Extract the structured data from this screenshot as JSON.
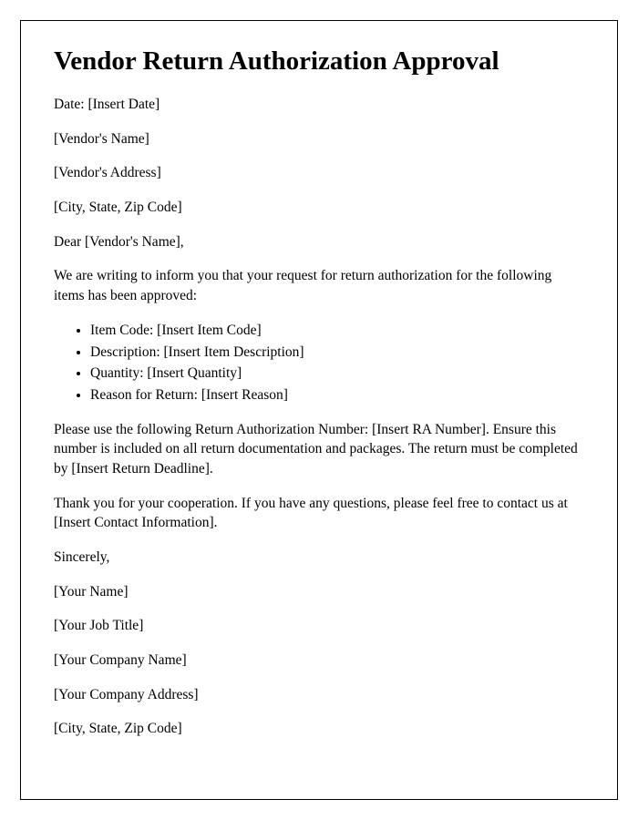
{
  "title": "Vendor Return Authorization Approval",
  "date_line": "Date: [Insert Date]",
  "vendor_name": "[Vendor's Name]",
  "vendor_address": "[Vendor's Address]",
  "vendor_city": "[City, State, Zip Code]",
  "salutation": "Dear [Vendor's Name],",
  "intro": "We are writing to inform you that your request for return authorization for the following items has been approved:",
  "items": [
    "Item Code: [Insert Item Code]",
    "Description: [Insert Item Description]",
    "Quantity: [Insert Quantity]",
    "Reason for Return: [Insert Reason]"
  ],
  "ra_paragraph": "Please use the following Return Authorization Number: [Insert RA Number]. Ensure this number is included on all return documentation and packages. The return must be completed by [Insert Return Deadline].",
  "thanks": "Thank you for your cooperation. If you have any questions, please feel free to contact us at [Insert Contact Information].",
  "closing": "Sincerely,",
  "sender_name": "[Your Name]",
  "sender_title": "[Your Job Title]",
  "sender_company": "[Your Company Name]",
  "sender_address": "[Your Company Address]",
  "sender_city": "[City, State, Zip Code]"
}
